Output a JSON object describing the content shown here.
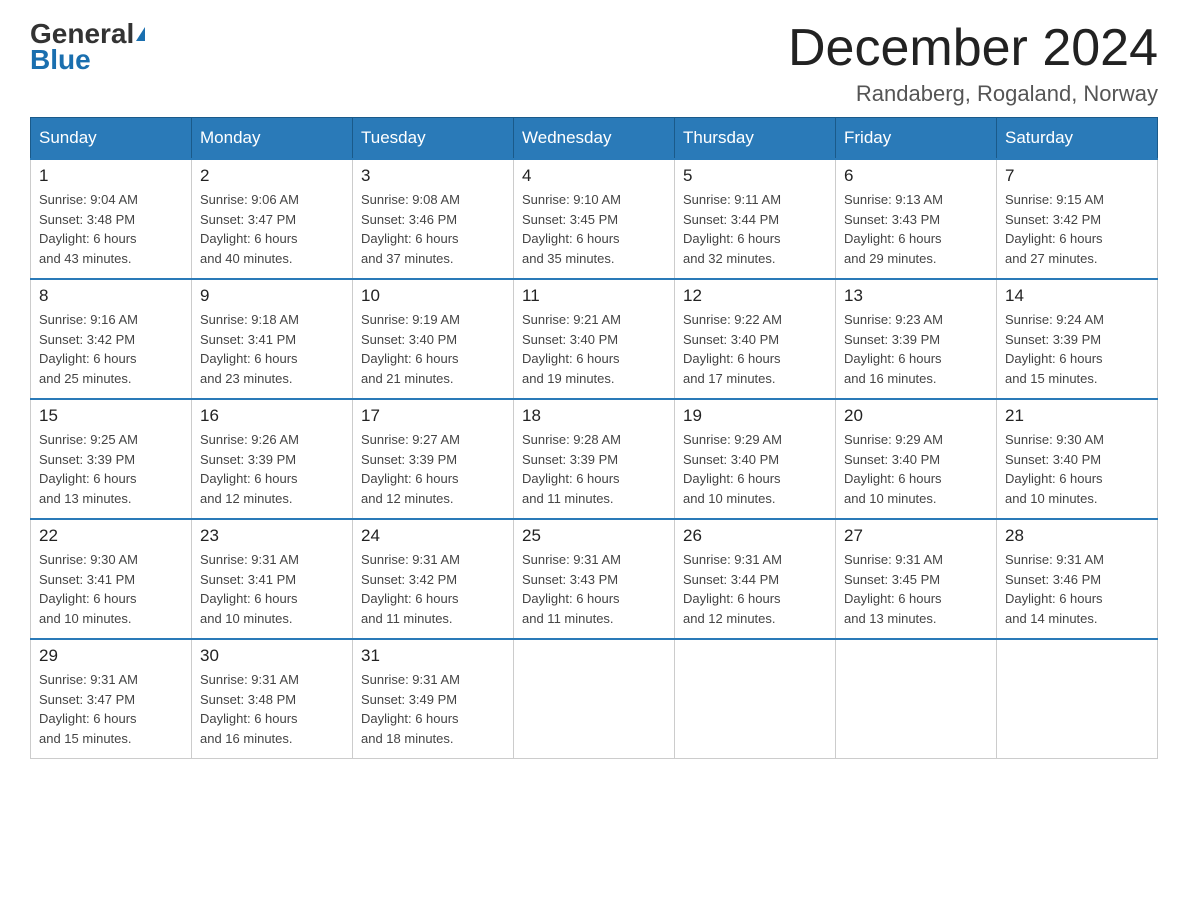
{
  "header": {
    "logo_line1": "General",
    "logo_line2": "Blue",
    "month_title": "December 2024",
    "location": "Randaberg, Rogaland, Norway"
  },
  "days_of_week": [
    "Sunday",
    "Monday",
    "Tuesday",
    "Wednesday",
    "Thursday",
    "Friday",
    "Saturday"
  ],
  "weeks": [
    [
      {
        "day": "1",
        "sunrise": "9:04 AM",
        "sunset": "3:48 PM",
        "daylight": "6 hours and 43 minutes."
      },
      {
        "day": "2",
        "sunrise": "9:06 AM",
        "sunset": "3:47 PM",
        "daylight": "6 hours and 40 minutes."
      },
      {
        "day": "3",
        "sunrise": "9:08 AM",
        "sunset": "3:46 PM",
        "daylight": "6 hours and 37 minutes."
      },
      {
        "day": "4",
        "sunrise": "9:10 AM",
        "sunset": "3:45 PM",
        "daylight": "6 hours and 35 minutes."
      },
      {
        "day": "5",
        "sunrise": "9:11 AM",
        "sunset": "3:44 PM",
        "daylight": "6 hours and 32 minutes."
      },
      {
        "day": "6",
        "sunrise": "9:13 AM",
        "sunset": "3:43 PM",
        "daylight": "6 hours and 29 minutes."
      },
      {
        "day": "7",
        "sunrise": "9:15 AM",
        "sunset": "3:42 PM",
        "daylight": "6 hours and 27 minutes."
      }
    ],
    [
      {
        "day": "8",
        "sunrise": "9:16 AM",
        "sunset": "3:42 PM",
        "daylight": "6 hours and 25 minutes."
      },
      {
        "day": "9",
        "sunrise": "9:18 AM",
        "sunset": "3:41 PM",
        "daylight": "6 hours and 23 minutes."
      },
      {
        "day": "10",
        "sunrise": "9:19 AM",
        "sunset": "3:40 PM",
        "daylight": "6 hours and 21 minutes."
      },
      {
        "day": "11",
        "sunrise": "9:21 AM",
        "sunset": "3:40 PM",
        "daylight": "6 hours and 19 minutes."
      },
      {
        "day": "12",
        "sunrise": "9:22 AM",
        "sunset": "3:40 PM",
        "daylight": "6 hours and 17 minutes."
      },
      {
        "day": "13",
        "sunrise": "9:23 AM",
        "sunset": "3:39 PM",
        "daylight": "6 hours and 16 minutes."
      },
      {
        "day": "14",
        "sunrise": "9:24 AM",
        "sunset": "3:39 PM",
        "daylight": "6 hours and 15 minutes."
      }
    ],
    [
      {
        "day": "15",
        "sunrise": "9:25 AM",
        "sunset": "3:39 PM",
        "daylight": "6 hours and 13 minutes."
      },
      {
        "day": "16",
        "sunrise": "9:26 AM",
        "sunset": "3:39 PM",
        "daylight": "6 hours and 12 minutes."
      },
      {
        "day": "17",
        "sunrise": "9:27 AM",
        "sunset": "3:39 PM",
        "daylight": "6 hours and 12 minutes."
      },
      {
        "day": "18",
        "sunrise": "9:28 AM",
        "sunset": "3:39 PM",
        "daylight": "6 hours and 11 minutes."
      },
      {
        "day": "19",
        "sunrise": "9:29 AM",
        "sunset": "3:40 PM",
        "daylight": "6 hours and 10 minutes."
      },
      {
        "day": "20",
        "sunrise": "9:29 AM",
        "sunset": "3:40 PM",
        "daylight": "6 hours and 10 minutes."
      },
      {
        "day": "21",
        "sunrise": "9:30 AM",
        "sunset": "3:40 PM",
        "daylight": "6 hours and 10 minutes."
      }
    ],
    [
      {
        "day": "22",
        "sunrise": "9:30 AM",
        "sunset": "3:41 PM",
        "daylight": "6 hours and 10 minutes."
      },
      {
        "day": "23",
        "sunrise": "9:31 AM",
        "sunset": "3:41 PM",
        "daylight": "6 hours and 10 minutes."
      },
      {
        "day": "24",
        "sunrise": "9:31 AM",
        "sunset": "3:42 PM",
        "daylight": "6 hours and 11 minutes."
      },
      {
        "day": "25",
        "sunrise": "9:31 AM",
        "sunset": "3:43 PM",
        "daylight": "6 hours and 11 minutes."
      },
      {
        "day": "26",
        "sunrise": "9:31 AM",
        "sunset": "3:44 PM",
        "daylight": "6 hours and 12 minutes."
      },
      {
        "day": "27",
        "sunrise": "9:31 AM",
        "sunset": "3:45 PM",
        "daylight": "6 hours and 13 minutes."
      },
      {
        "day": "28",
        "sunrise": "9:31 AM",
        "sunset": "3:46 PM",
        "daylight": "6 hours and 14 minutes."
      }
    ],
    [
      {
        "day": "29",
        "sunrise": "9:31 AM",
        "sunset": "3:47 PM",
        "daylight": "6 hours and 15 minutes."
      },
      {
        "day": "30",
        "sunrise": "9:31 AM",
        "sunset": "3:48 PM",
        "daylight": "6 hours and 16 minutes."
      },
      {
        "day": "31",
        "sunrise": "9:31 AM",
        "sunset": "3:49 PM",
        "daylight": "6 hours and 18 minutes."
      },
      null,
      null,
      null,
      null
    ]
  ],
  "labels": {
    "sunrise": "Sunrise:",
    "sunset": "Sunset:",
    "daylight": "Daylight:"
  }
}
